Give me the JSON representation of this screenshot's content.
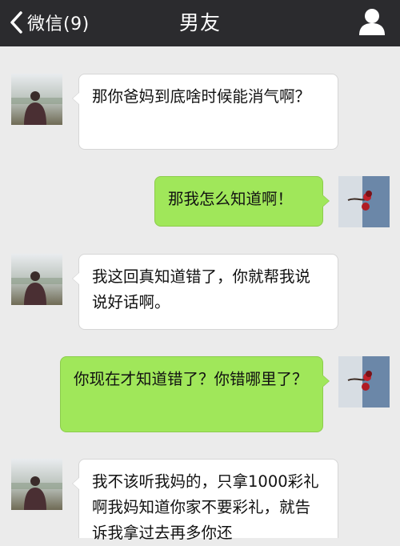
{
  "header": {
    "back_label": "微信(9)",
    "title": "男友"
  },
  "messages": [
    {
      "side": "in",
      "text": "那你爸妈到底啥时候能消气啊？"
    },
    {
      "side": "out",
      "text": "那我怎么知道啊！"
    },
    {
      "side": "in",
      "text": "我这回真知道错了，你就帮我说说好话啊。"
    },
    {
      "side": "out",
      "text": "你现在才知道错了？你错哪里了？"
    },
    {
      "side": "in",
      "text": "我不该听我妈的，只拿1000彩礼啊我妈知道你家不要彩礼，就告诉我拿过去再多你还"
    }
  ],
  "colors": {
    "topbar": "#2b2b2e",
    "background": "#ebebeb",
    "incoming_bubble": "#ffffff",
    "outgoing_bubble": "#a0e75a"
  },
  "icons": {
    "back": "chevron-left-icon",
    "profile": "person-icon"
  }
}
